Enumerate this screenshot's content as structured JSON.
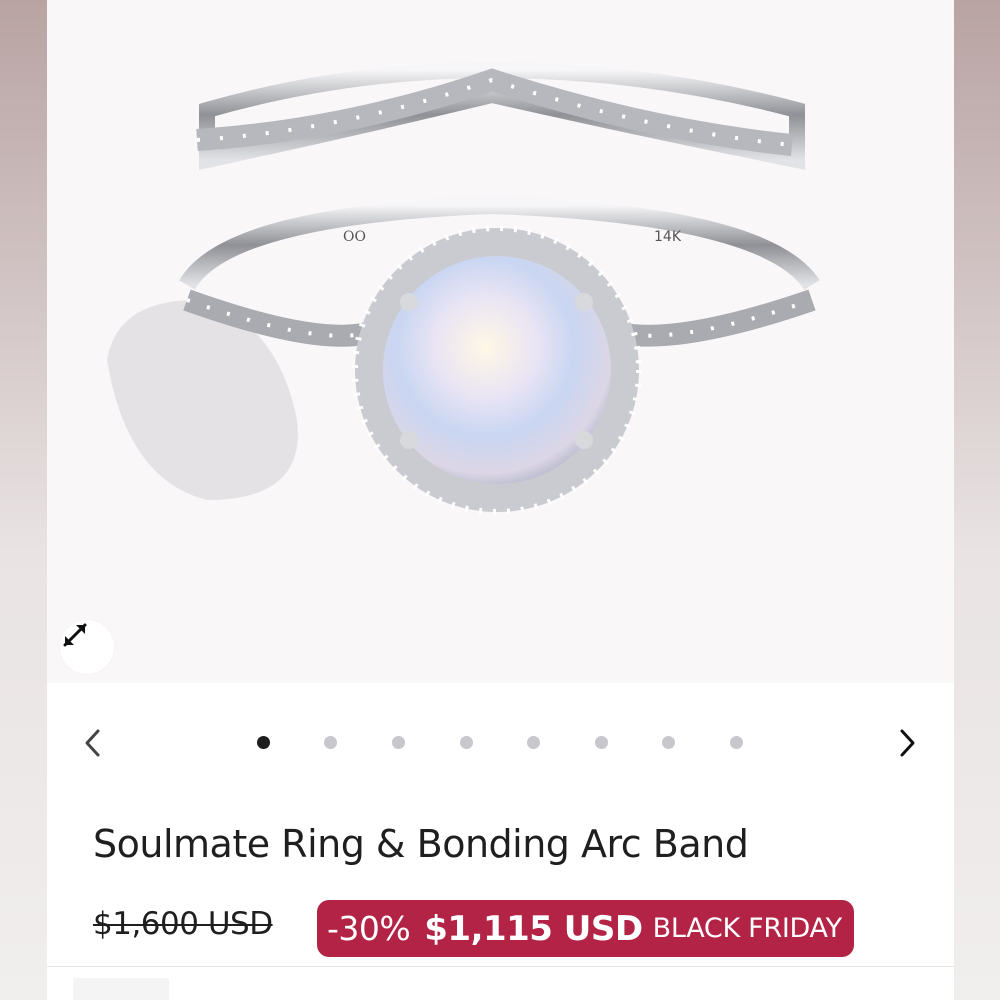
{
  "product": {
    "title": "Soulmate Ring & Bonding Arc Band",
    "ring_engraving_logo": "OO",
    "ring_engraving_karat": "14K"
  },
  "gallery": {
    "slide_count": 8,
    "active_index": 0,
    "expand_icon": "expand-arrows-icon",
    "prev_icon": "chevron-left-icon",
    "next_icon": "chevron-right-icon"
  },
  "pricing": {
    "original_price": "$1,600 USD",
    "discount": "-30%",
    "sale_price": "$1,115 USD",
    "promo_label": "BLACK FRIDAY"
  },
  "colors": {
    "sale_badge": "#b32346",
    "active_dot": "#1e1e1e",
    "inactive_dot": "#c7c7cc",
    "text": "#1f1f1f"
  }
}
